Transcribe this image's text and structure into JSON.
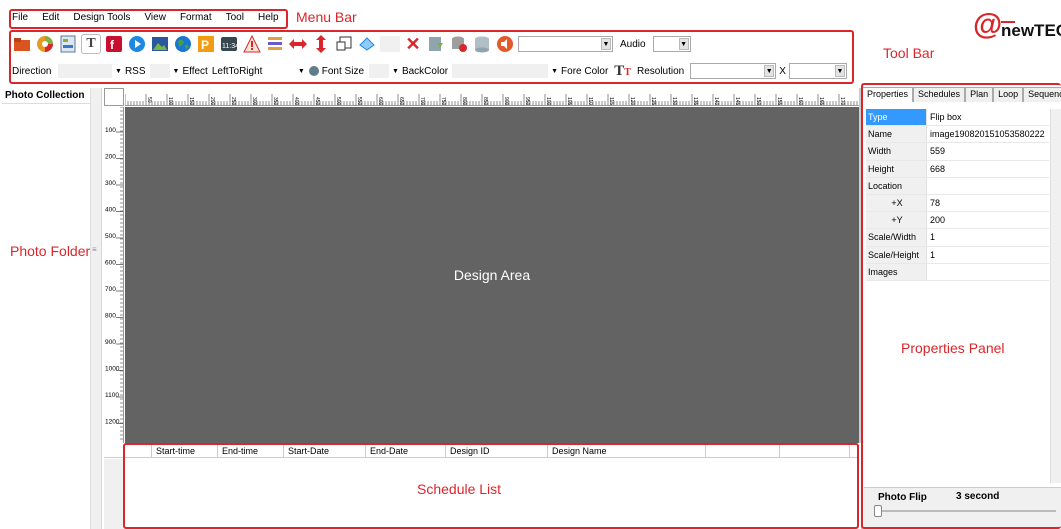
{
  "menu": {
    "items": [
      "File",
      "Edit",
      "Design Tools",
      "View",
      "Format",
      "Tool",
      "Help"
    ]
  },
  "annotations": {
    "menu_bar": "Menu Bar",
    "tool_bar": "Tool Bar",
    "photo_folder": "Photo Folder",
    "design_area": "Design Area",
    "schedule_list": "Schedule List",
    "properties_panel": "Properties Panel"
  },
  "logo": {
    "at": "@",
    "text": "newTEC"
  },
  "toolbar": {
    "audio_label": "Audio",
    "icons": [
      "folder-icon",
      "pie-icon",
      "gallery-icon",
      "text-icon",
      "flash-icon",
      "play-icon",
      "image-icon",
      "globe-icon",
      "powerpoint-icon",
      "clock-icon",
      "warning-icon",
      "list-icon",
      "horizontal-arrow-icon",
      "vertical-arrow-icon",
      "resize-icon",
      "shape-icon",
      "delete-icon",
      "download-icon",
      "database-delete-icon",
      "database-icon",
      "speaker-icon"
    ]
  },
  "toolbar2": {
    "direction_label": "Direction",
    "rss_label": "RSS",
    "effect_label": "Effect",
    "effect_value": "LeftToRight",
    "font_size_label": "Font Size",
    "backcolor_label": "BackColor",
    "forecolor_label": "Fore Color",
    "resolution_label": "Resolution",
    "x_label": "X"
  },
  "left_panel": {
    "title": "Photo Collection"
  },
  "ruler": {
    "h": [
      "50",
      "100",
      "150",
      "200",
      "250",
      "300",
      "350",
      "400",
      "450",
      "500",
      "550",
      "600",
      "650",
      "700",
      "750",
      "800",
      "850",
      "900",
      "950",
      "1000",
      "1050",
      "1100",
      "1150",
      "1200",
      "1250",
      "1300",
      "1350",
      "1400",
      "1450",
      "1500",
      "1550",
      "1600",
      "1650",
      "1700",
      "1750"
    ],
    "v": [
      "100",
      "200",
      "300",
      "400",
      "500",
      "600",
      "700",
      "800",
      "900",
      "1000",
      "1100",
      "1200"
    ]
  },
  "schedule": {
    "columns": [
      "Start-time",
      "End-time",
      "Start-Date",
      "End-Date",
      "Design ID",
      "Design Name"
    ]
  },
  "properties": {
    "tabs": [
      "Properties",
      "Schedules",
      "Plan",
      "Loop",
      "Sequence"
    ],
    "rows": [
      {
        "key": "Type",
        "value": "Flip box"
      },
      {
        "key": "Name",
        "value": "image190820151053580222"
      },
      {
        "key": "Width",
        "value": "559"
      },
      {
        "key": "Height",
        "value": "668"
      },
      {
        "key": "Location",
        "value": ""
      },
      {
        "key": "+X",
        "value": "78"
      },
      {
        "key": "+Y",
        "value": "200"
      },
      {
        "key": "Scale/Width",
        "value": "1"
      },
      {
        "key": "Scale/Height",
        "value": "1"
      },
      {
        "key": "Images",
        "value": ""
      }
    ],
    "footer_label": "Photo Flip",
    "footer_value": "3 second"
  }
}
